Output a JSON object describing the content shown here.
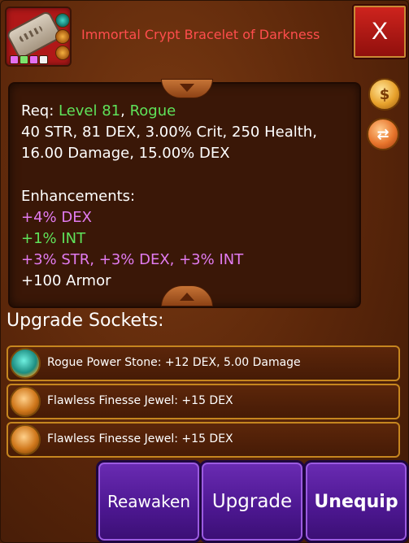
{
  "item": {
    "title": "Immortal Crypt Bracelet of Darkness",
    "icon": "bracelet-icon"
  },
  "close_label": "X",
  "stats": {
    "req_prefix": "Req: ",
    "req_level": "Level 81",
    "req_separator": ", ",
    "req_class": "Rogue",
    "line1": "40 STR, 81 DEX, 3.00% Crit, 250 Health,",
    "line2": "16.00 Damage, 15.00% DEX",
    "enhancements_title": "Enhancements:",
    "enh1": "+4% DEX",
    "enh2": "+1% INT",
    "enh3": "+3% STR, +3% DEX, +3% INT",
    "enh4": "+100 Armor"
  },
  "upgrade_sockets_title": "Upgrade Sockets:",
  "sockets": [
    {
      "text": "Rogue Power Stone: +12 DEX, 5.00 Damage",
      "gem": "teal"
    },
    {
      "text": "Flawless Finesse Jewel: +15 DEX",
      "gem": "orange"
    },
    {
      "text": "Flawless Finesse Jewel: +15 DEX",
      "gem": "orange"
    }
  ],
  "buttons": {
    "reawaken": "Reawaken",
    "upgrade": "Upgrade",
    "unequip": "Unequip"
  },
  "colors": {
    "title": "#ff4d4d",
    "green": "#5fe35a",
    "pink": "#e27bf0",
    "button_purple": "#4c1790"
  }
}
